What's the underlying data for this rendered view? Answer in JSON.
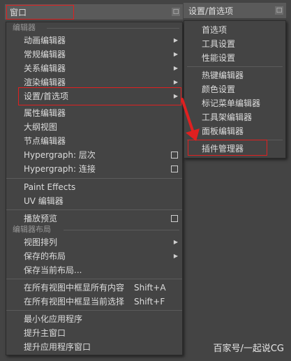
{
  "main_menu": {
    "title": "窗口",
    "tear_off_glyph": "□",
    "sections": {
      "editors": "编辑器",
      "editor_layouts": "编辑器布局"
    },
    "items": {
      "animation_editors": "动画编辑器",
      "general_editors": "常规编辑器",
      "relationship_editors": "关系编辑器",
      "rendering_editors": "渲染编辑器",
      "settings_preferences": "设置/首选项",
      "attribute_editor": "属性编辑器",
      "outliner": "大纲视图",
      "node_editor": "节点编辑器",
      "hypergraph_hierarchy": "Hypergraph: 层次",
      "hypergraph_connections": "Hypergraph: 连接",
      "paint_effects": "Paint Effects",
      "uv_editor": "UV 编辑器",
      "playblast": "播放预览",
      "view_arrangement": "视图排列",
      "saved_layouts": "保存的布局",
      "save_current_layout": "保存当前布局...",
      "frame_all_in_all_views": "在所有视图中框显所有内容",
      "frame_all_shortcut": "Shift+A",
      "frame_selection_in_all_views": "在所有视图中框显当前选择",
      "frame_selection_shortcut": "Shift+F",
      "minimize_application": "最小化应用程序",
      "raise_main_window": "提升主窗口",
      "raise_application_windows": "提升应用程序窗口"
    }
  },
  "submenu": {
    "title": "设置/首选项",
    "tear_off_glyph": "□",
    "items": {
      "preferences": "首选项",
      "tool_settings": "工具设置",
      "performance_settings": "性能设置",
      "hotkey_editor": "热键编辑器",
      "color_settings": "颜色设置",
      "marking_menu_editor": "标记菜单编辑器",
      "shelf_editor": "工具架编辑器",
      "panel_editor": "面板编辑器",
      "plugin_manager": "插件管理器"
    }
  },
  "icons": {
    "submenu_arrow": "▶"
  },
  "colors": {
    "highlight_red": "#e02020",
    "menu_bg": "#444444"
  },
  "watermark": "百家号/一起说CG"
}
